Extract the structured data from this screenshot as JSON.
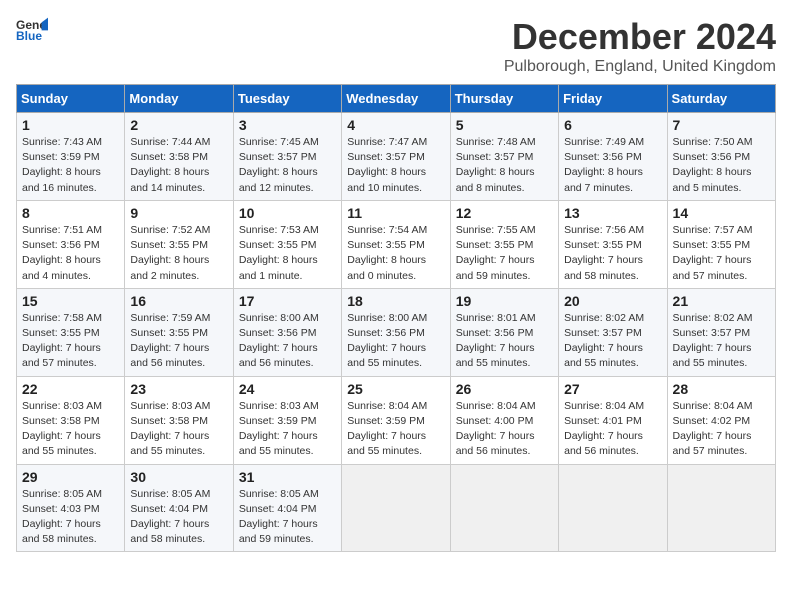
{
  "logo": {
    "line1": "General",
    "line2": "Blue"
  },
  "title": "December 2024",
  "location": "Pulborough, England, United Kingdom",
  "days_of_week": [
    "Sunday",
    "Monday",
    "Tuesday",
    "Wednesday",
    "Thursday",
    "Friday",
    "Saturday"
  ],
  "weeks": [
    [
      {
        "day": "1",
        "sunrise": "Sunrise: 7:43 AM",
        "sunset": "Sunset: 3:59 PM",
        "daylight": "Daylight: 8 hours and 16 minutes."
      },
      {
        "day": "2",
        "sunrise": "Sunrise: 7:44 AM",
        "sunset": "Sunset: 3:58 PM",
        "daylight": "Daylight: 8 hours and 14 minutes."
      },
      {
        "day": "3",
        "sunrise": "Sunrise: 7:45 AM",
        "sunset": "Sunset: 3:57 PM",
        "daylight": "Daylight: 8 hours and 12 minutes."
      },
      {
        "day": "4",
        "sunrise": "Sunrise: 7:47 AM",
        "sunset": "Sunset: 3:57 PM",
        "daylight": "Daylight: 8 hours and 10 minutes."
      },
      {
        "day": "5",
        "sunrise": "Sunrise: 7:48 AM",
        "sunset": "Sunset: 3:57 PM",
        "daylight": "Daylight: 8 hours and 8 minutes."
      },
      {
        "day": "6",
        "sunrise": "Sunrise: 7:49 AM",
        "sunset": "Sunset: 3:56 PM",
        "daylight": "Daylight: 8 hours and 7 minutes."
      },
      {
        "day": "7",
        "sunrise": "Sunrise: 7:50 AM",
        "sunset": "Sunset: 3:56 PM",
        "daylight": "Daylight: 8 hours and 5 minutes."
      }
    ],
    [
      {
        "day": "8",
        "sunrise": "Sunrise: 7:51 AM",
        "sunset": "Sunset: 3:56 PM",
        "daylight": "Daylight: 8 hours and 4 minutes."
      },
      {
        "day": "9",
        "sunrise": "Sunrise: 7:52 AM",
        "sunset": "Sunset: 3:55 PM",
        "daylight": "Daylight: 8 hours and 2 minutes."
      },
      {
        "day": "10",
        "sunrise": "Sunrise: 7:53 AM",
        "sunset": "Sunset: 3:55 PM",
        "daylight": "Daylight: 8 hours and 1 minute."
      },
      {
        "day": "11",
        "sunrise": "Sunrise: 7:54 AM",
        "sunset": "Sunset: 3:55 PM",
        "daylight": "Daylight: 8 hours and 0 minutes."
      },
      {
        "day": "12",
        "sunrise": "Sunrise: 7:55 AM",
        "sunset": "Sunset: 3:55 PM",
        "daylight": "Daylight: 7 hours and 59 minutes."
      },
      {
        "day": "13",
        "sunrise": "Sunrise: 7:56 AM",
        "sunset": "Sunset: 3:55 PM",
        "daylight": "Daylight: 7 hours and 58 minutes."
      },
      {
        "day": "14",
        "sunrise": "Sunrise: 7:57 AM",
        "sunset": "Sunset: 3:55 PM",
        "daylight": "Daylight: 7 hours and 57 minutes."
      }
    ],
    [
      {
        "day": "15",
        "sunrise": "Sunrise: 7:58 AM",
        "sunset": "Sunset: 3:55 PM",
        "daylight": "Daylight: 7 hours and 57 minutes."
      },
      {
        "day": "16",
        "sunrise": "Sunrise: 7:59 AM",
        "sunset": "Sunset: 3:55 PM",
        "daylight": "Daylight: 7 hours and 56 minutes."
      },
      {
        "day": "17",
        "sunrise": "Sunrise: 8:00 AM",
        "sunset": "Sunset: 3:56 PM",
        "daylight": "Daylight: 7 hours and 56 minutes."
      },
      {
        "day": "18",
        "sunrise": "Sunrise: 8:00 AM",
        "sunset": "Sunset: 3:56 PM",
        "daylight": "Daylight: 7 hours and 55 minutes."
      },
      {
        "day": "19",
        "sunrise": "Sunrise: 8:01 AM",
        "sunset": "Sunset: 3:56 PM",
        "daylight": "Daylight: 7 hours and 55 minutes."
      },
      {
        "day": "20",
        "sunrise": "Sunrise: 8:02 AM",
        "sunset": "Sunset: 3:57 PM",
        "daylight": "Daylight: 7 hours and 55 minutes."
      },
      {
        "day": "21",
        "sunrise": "Sunrise: 8:02 AM",
        "sunset": "Sunset: 3:57 PM",
        "daylight": "Daylight: 7 hours and 55 minutes."
      }
    ],
    [
      {
        "day": "22",
        "sunrise": "Sunrise: 8:03 AM",
        "sunset": "Sunset: 3:58 PM",
        "daylight": "Daylight: 7 hours and 55 minutes."
      },
      {
        "day": "23",
        "sunrise": "Sunrise: 8:03 AM",
        "sunset": "Sunset: 3:58 PM",
        "daylight": "Daylight: 7 hours and 55 minutes."
      },
      {
        "day": "24",
        "sunrise": "Sunrise: 8:03 AM",
        "sunset": "Sunset: 3:59 PM",
        "daylight": "Daylight: 7 hours and 55 minutes."
      },
      {
        "day": "25",
        "sunrise": "Sunrise: 8:04 AM",
        "sunset": "Sunset: 3:59 PM",
        "daylight": "Daylight: 7 hours and 55 minutes."
      },
      {
        "day": "26",
        "sunrise": "Sunrise: 8:04 AM",
        "sunset": "Sunset: 4:00 PM",
        "daylight": "Daylight: 7 hours and 56 minutes."
      },
      {
        "day": "27",
        "sunrise": "Sunrise: 8:04 AM",
        "sunset": "Sunset: 4:01 PM",
        "daylight": "Daylight: 7 hours and 56 minutes."
      },
      {
        "day": "28",
        "sunrise": "Sunrise: 8:04 AM",
        "sunset": "Sunset: 4:02 PM",
        "daylight": "Daylight: 7 hours and 57 minutes."
      }
    ],
    [
      {
        "day": "29",
        "sunrise": "Sunrise: 8:05 AM",
        "sunset": "Sunset: 4:03 PM",
        "daylight": "Daylight: 7 hours and 58 minutes."
      },
      {
        "day": "30",
        "sunrise": "Sunrise: 8:05 AM",
        "sunset": "Sunset: 4:04 PM",
        "daylight": "Daylight: 7 hours and 58 minutes."
      },
      {
        "day": "31",
        "sunrise": "Sunrise: 8:05 AM",
        "sunset": "Sunset: 4:04 PM",
        "daylight": "Daylight: 7 hours and 59 minutes."
      },
      null,
      null,
      null,
      null
    ]
  ]
}
